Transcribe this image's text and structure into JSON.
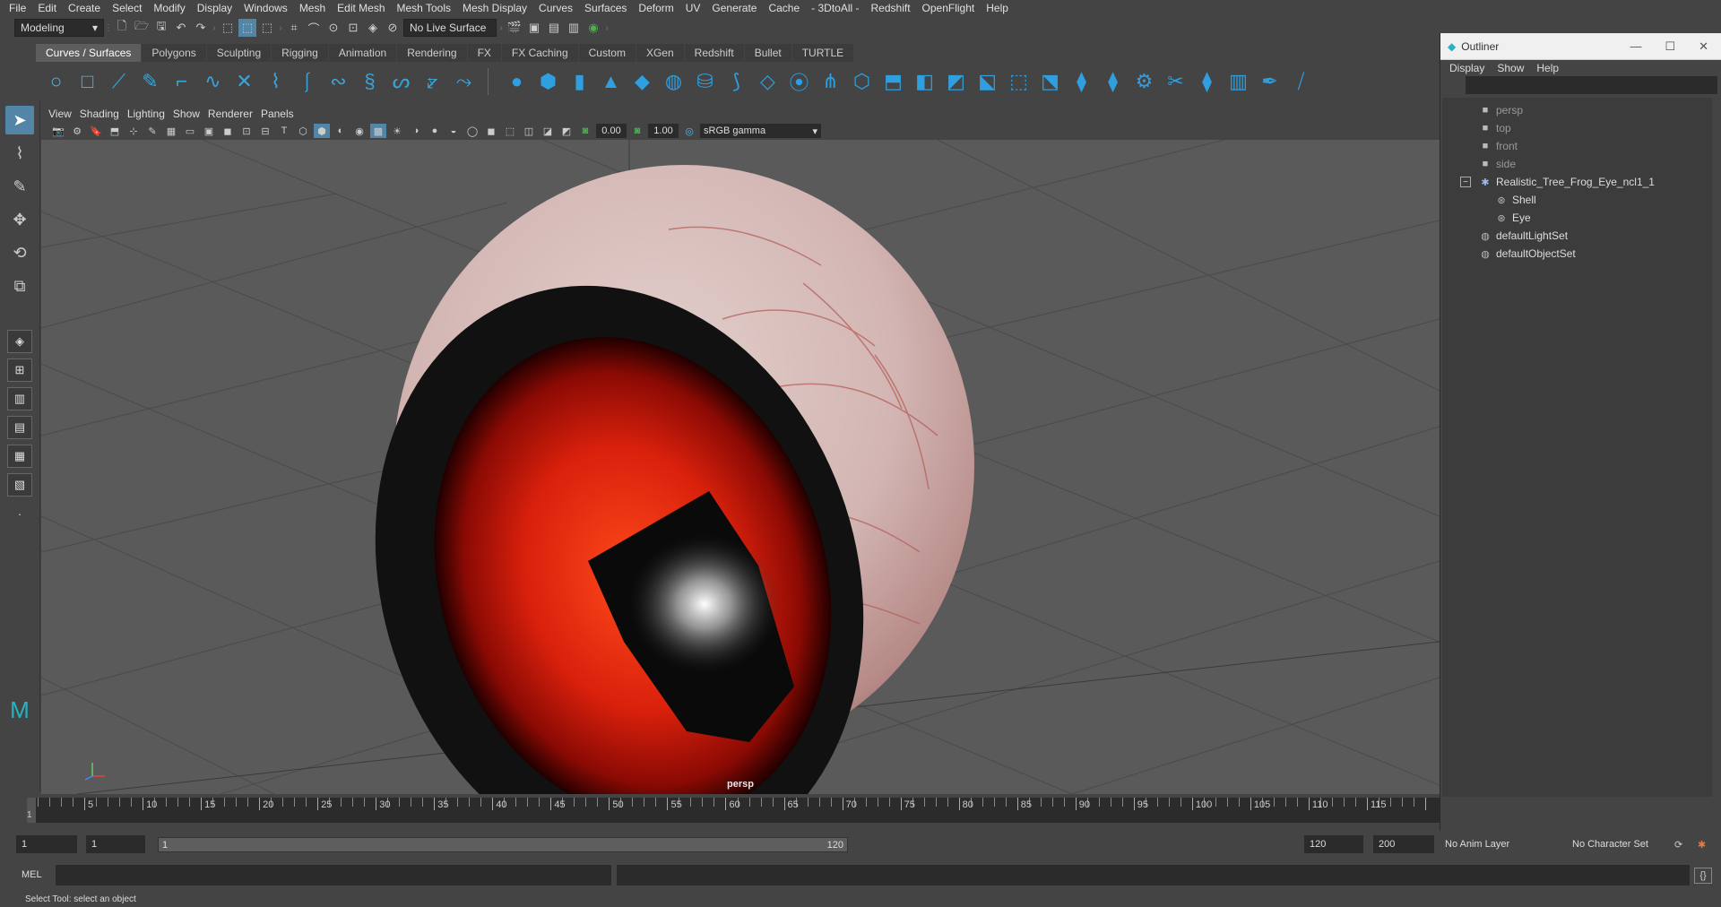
{
  "menubar": {
    "items": [
      "File",
      "Edit",
      "Create",
      "Select",
      "Modify",
      "Display",
      "Windows",
      "Mesh",
      "Edit Mesh",
      "Mesh Tools",
      "Mesh Display",
      "Curves",
      "Surfaces",
      "Deform",
      "UV",
      "Generate",
      "Cache",
      "- 3DtoAll -",
      "Redshift",
      "OpenFlight",
      "Help"
    ]
  },
  "statusline": {
    "menuset": "Modeling",
    "live_surface": "No Live Surface"
  },
  "shelf": {
    "tabs": [
      "Curves / Surfaces",
      "Polygons",
      "Sculpting",
      "Rigging",
      "Animation",
      "Rendering",
      "FX",
      "FX Caching",
      "Custom",
      "XGen",
      "Redshift",
      "Bullet",
      "TURTLE"
    ],
    "active_tab": "Curves / Surfaces"
  },
  "panel": {
    "menus": [
      "View",
      "Shading",
      "Lighting",
      "Show",
      "Renderer",
      "Panels"
    ],
    "exposure": "0.00",
    "gamma": "1.00",
    "color_space": "sRGB gamma",
    "camera_label": "persp"
  },
  "outliner": {
    "title": "Outliner",
    "menus": [
      "Display",
      "Show",
      "Help"
    ],
    "items": [
      {
        "label": "persp",
        "icon": "camera-icon",
        "level": 0,
        "kind": "camera"
      },
      {
        "label": "top",
        "icon": "camera-icon",
        "level": 0,
        "kind": "camera"
      },
      {
        "label": "front",
        "icon": "camera-icon",
        "level": 0,
        "kind": "camera"
      },
      {
        "label": "side",
        "icon": "camera-icon",
        "level": 0,
        "kind": "camera"
      },
      {
        "label": "Realistic_Tree_Frog_Eye_ncl1_1",
        "icon": "group-icon",
        "level": 0,
        "kind": "group",
        "expanded": true
      },
      {
        "label": "Shell",
        "icon": "mesh-icon",
        "level": 1,
        "kind": "mesh"
      },
      {
        "label": "Eye",
        "icon": "mesh-icon",
        "level": 1,
        "kind": "mesh"
      },
      {
        "label": "defaultLightSet",
        "icon": "set-icon",
        "level": 0,
        "kind": "set"
      },
      {
        "label": "defaultObjectSet",
        "icon": "set-icon",
        "level": 0,
        "kind": "set"
      }
    ]
  },
  "timeline": {
    "ticks": [
      1,
      5,
      10,
      15,
      20,
      25,
      30,
      35,
      40,
      45,
      50,
      55,
      60,
      65,
      70,
      75,
      80,
      85,
      90,
      95,
      100,
      105,
      110,
      115
    ],
    "current_frame": "1",
    "range_max": 120
  },
  "range": {
    "start": "1",
    "anim_start": "1",
    "slider_start": "1",
    "slider_end": "120",
    "end": "120",
    "anim_end": "200",
    "anim_layer": "No Anim Layer",
    "character_set": "No Character Set"
  },
  "cmdline": {
    "language": "MEL"
  },
  "helpline": {
    "text": "Select Tool: select an object"
  },
  "colors": {
    "accent": "#5285a6",
    "shelf_icon": "#3aa4d6",
    "viewport_bg": "#5a5a5a",
    "iris": "#c8200c",
    "sclera": "#d8c3c1"
  }
}
